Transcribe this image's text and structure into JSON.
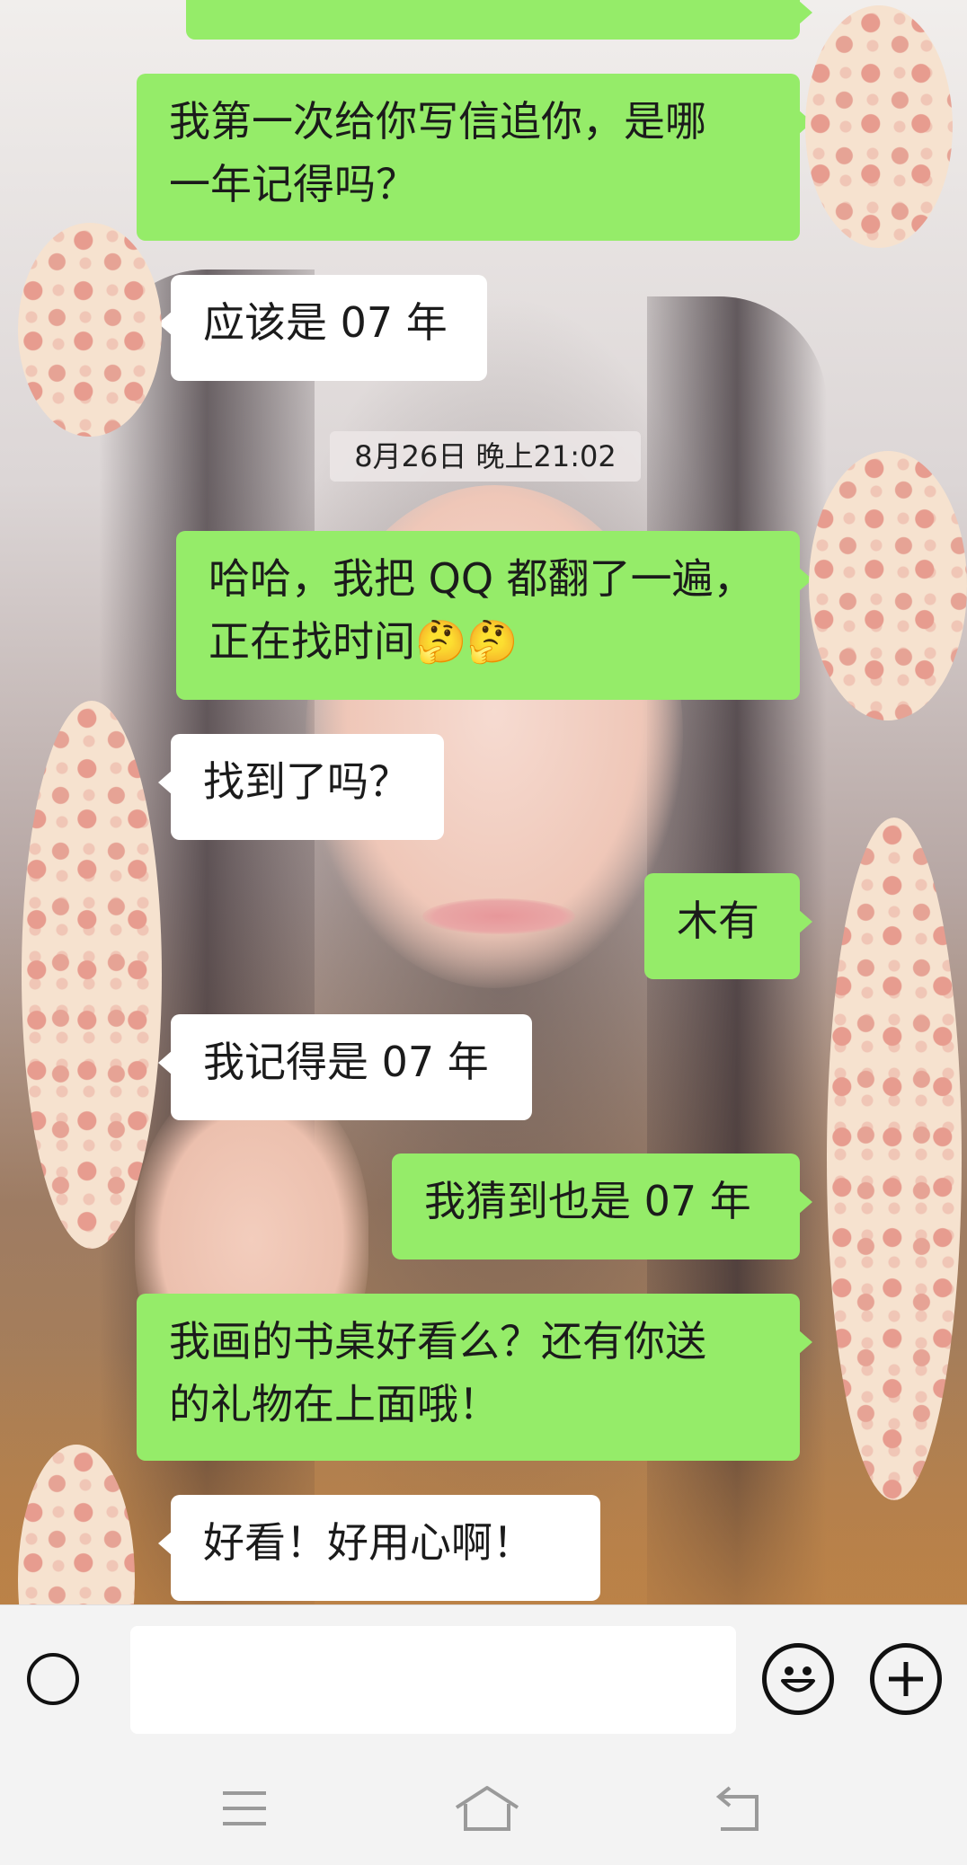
{
  "messages": [
    {
      "from": "me",
      "lines": [
        "我第一次给你写信追你，是哪",
        "一年记得吗？"
      ]
    },
    {
      "from": "them",
      "text": "应该是 07 年"
    },
    {
      "from": "me",
      "lines": [
        "哈哈，我把 QQ 都翻了一遍，",
        "正在找时间🤔🤔"
      ]
    },
    {
      "from": "them",
      "text": "找到了吗？"
    },
    {
      "from": "me",
      "text": "木有"
    },
    {
      "from": "them",
      "text": "我记得是 07 年"
    },
    {
      "from": "me",
      "text": "我猜到也是 07 年"
    },
    {
      "from": "me",
      "lines": [
        "我画的书桌好看么？还有你送",
        "的礼物在上面哦！"
      ]
    },
    {
      "from": "them",
      "text": "好看！好用心啊！"
    }
  ],
  "timestamp": "8月26日 晚上21:02",
  "input": {
    "value": ""
  },
  "colors": {
    "my_bubble": "#95ec69",
    "their_bubble": "#ffffff",
    "bar": "#f3f3f3"
  },
  "icons": [
    "voice-icon",
    "emoji-icon",
    "plus-icon",
    "menu-icon",
    "home-icon",
    "back-icon"
  ]
}
